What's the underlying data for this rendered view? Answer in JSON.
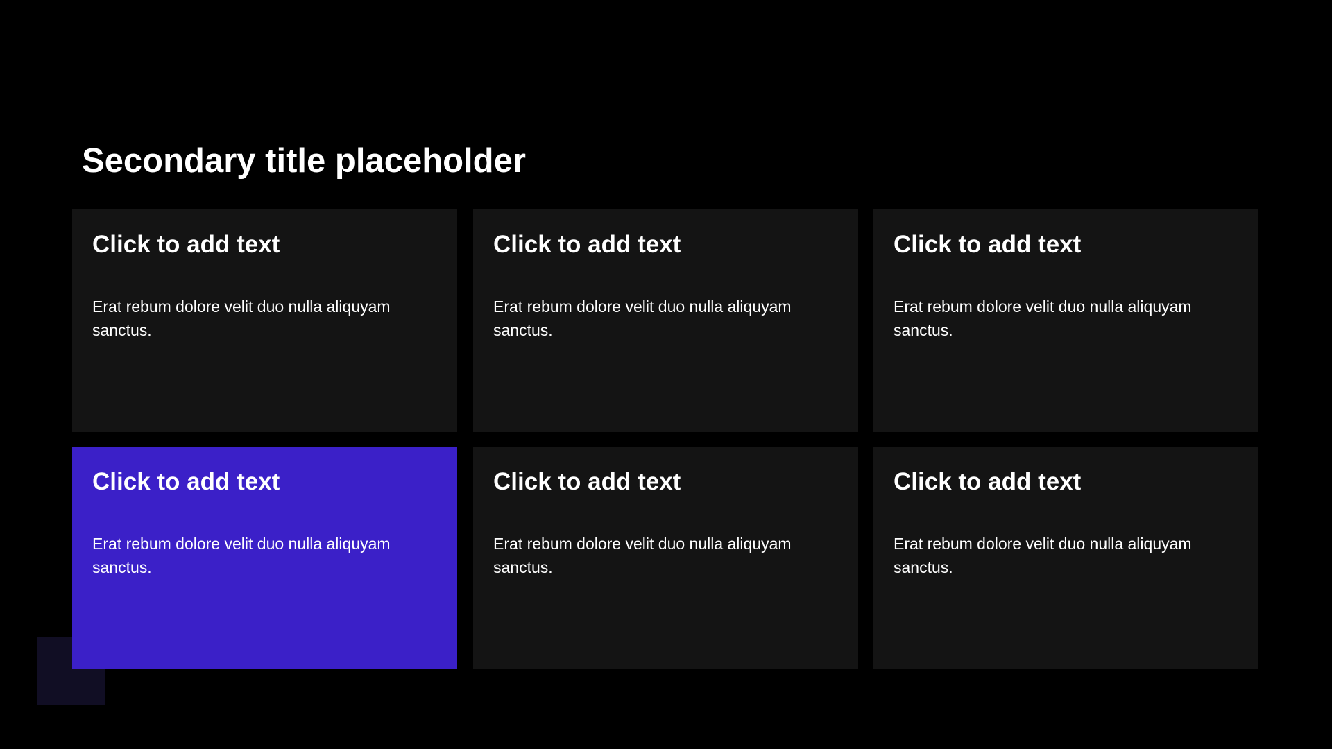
{
  "slide": {
    "title": "Secondary title placeholder",
    "accent_color": "#3b20c8",
    "card_color": "#141414",
    "cards": [
      {
        "heading": "Click to add text",
        "body": "Erat rebum dolore velit duo nulla aliquyam sanctus."
      },
      {
        "heading": "Click to add text",
        "body": "Erat rebum dolore velit duo nulla aliquyam sanctus."
      },
      {
        "heading": "Click to add text",
        "body": "Erat rebum dolore velit duo nulla aliquyam sanctus."
      },
      {
        "heading": "Click to add text",
        "body": "Erat rebum dolore velit duo nulla aliquyam sanctus."
      },
      {
        "heading": "Click to add text",
        "body": "Erat rebum dolore velit duo nulla aliquyam sanctus."
      },
      {
        "heading": "Click to add text",
        "body": "Erat rebum dolore velit duo nulla aliquyam sanctus."
      }
    ]
  }
}
